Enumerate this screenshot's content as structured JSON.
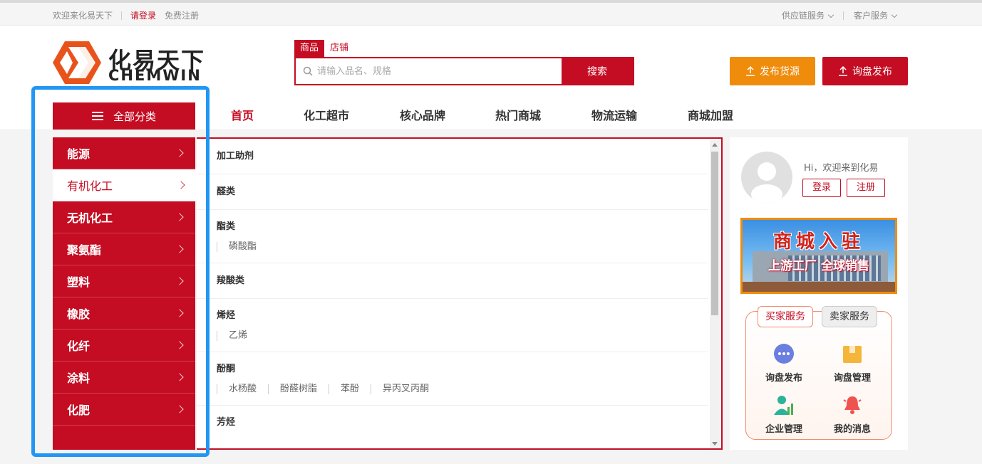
{
  "topbar": {
    "welcome": "欢迎来化易天下",
    "login": "请登录",
    "register": "免费注册",
    "supply_chain": "供应链服务",
    "customer_service": "客户服务"
  },
  "logo": {
    "cn": "化易天下",
    "en": "CHEMWIN"
  },
  "search": {
    "tabs": [
      "商品",
      "店铺"
    ],
    "placeholder": "请输入品名、规格",
    "button": "搜索"
  },
  "header_buttons": {
    "publish_supply": "发布货源",
    "publish_inquiry": "询盘发布"
  },
  "nav": {
    "all_categories": "全部分类",
    "items": [
      "首页",
      "化工超市",
      "核心品牌",
      "热门商城",
      "物流运输",
      "商城加盟"
    ]
  },
  "categories": [
    "能源",
    "有机化工",
    "无机化工",
    "聚氨酯",
    "塑料",
    "橡胶",
    "化纤",
    "涂料",
    "化肥"
  ],
  "subcategories": [
    {
      "title": "加工助剂",
      "items": []
    },
    {
      "title": "醛类",
      "items": []
    },
    {
      "title": "酯类",
      "items": [
        "磷酸酯"
      ]
    },
    {
      "title": "羧酸类",
      "items": []
    },
    {
      "title": "烯烃",
      "items": [
        "乙烯"
      ]
    },
    {
      "title": "酚酮",
      "items": [
        "水杨酸",
        "酚醛树脂",
        "苯酚",
        "异丙叉丙酮"
      ]
    },
    {
      "title": "芳烃",
      "items": []
    }
  ],
  "user_panel": {
    "welcome": "Hi，欢迎来到化易",
    "login": "登录",
    "register": "注册",
    "banner_title": "商城入驻",
    "banner_subtitle": "上游工厂 全球销售",
    "service_tabs": [
      "买家服务",
      "卖家服务"
    ],
    "services": [
      "询盘发布",
      "询盘管理",
      "企业管理",
      "我的消息"
    ]
  },
  "colors": {
    "brand_red": "#c40d23",
    "orange": "#f08c0c",
    "highlight_blue": "#2196f3"
  }
}
